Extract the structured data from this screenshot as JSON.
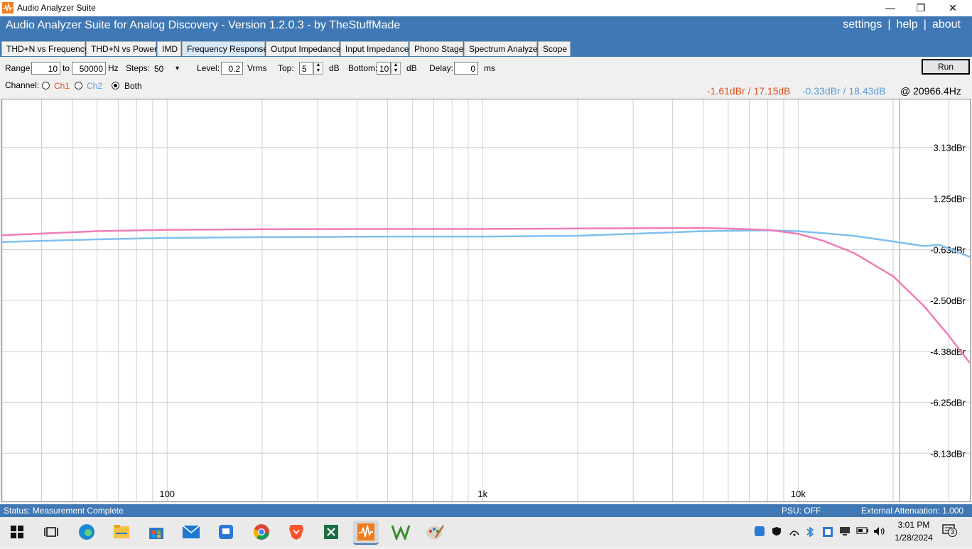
{
  "window": {
    "title": "Audio Analyzer Suite",
    "minimize": "—",
    "restore": "❐",
    "close": "✕"
  },
  "header": {
    "heading": "Audio Analyzer Suite for Analog Discovery - Version   1.2.0.3   - by TheStuffMade",
    "links": [
      "settings",
      "help",
      "about"
    ],
    "separator": "|"
  },
  "tabs": [
    "THD+N vs Frequency",
    "THD+N vs Power",
    "IMD",
    "Frequency Response",
    "Output Impedance",
    "Input Impedance",
    "Phono Stage",
    "Spectrum Analyzer",
    "Scope"
  ],
  "active_tab": 3,
  "controls": {
    "range_label": "Range:",
    "range_from": "10",
    "to_label": "to",
    "range_to": "50000",
    "hz_label": "Hz",
    "steps_label": "Steps:",
    "steps_value": "50",
    "steps_arrow": "▾",
    "level_label": "Level:",
    "level_value": "0.2",
    "vrms_label": "Vrms",
    "top_label": "Top:",
    "top_value": "5",
    "db1": "dB",
    "bottom_label": "Bottom:",
    "bottom_value": "10",
    "db2": "dB",
    "delay_label": "Delay:",
    "delay_value": "0",
    "ms_label": "ms",
    "run_label": "Run",
    "channel_label": "Channel:",
    "ch1": "Ch1",
    "ch2": "Ch2",
    "both": "Both",
    "selected_channel": "Both"
  },
  "readout": {
    "ch1": "-1.61dBr / 17.15dB",
    "ch2": "-0.33dBr / 18.43dB",
    "freq": "@ 20966.4Hz"
  },
  "colors": {
    "ch1": "#ef7db8",
    "ch2": "#7fc0ef",
    "cursor": "#d9b44a",
    "header": "#3f78b4",
    "ch1_text": "#e05020",
    "ch2_text": "#5b9bd5"
  },
  "chart_data": {
    "type": "line",
    "x_scale": "log",
    "xlim": [
      30,
      35000
    ],
    "ylim": [
      -9.9,
      4.9
    ],
    "x_tick_labels": [
      {
        "x": 100,
        "label": "100"
      },
      {
        "x": 1000,
        "label": "1k"
      },
      {
        "x": 10000,
        "label": "10k"
      }
    ],
    "y_ticks": [
      {
        "y": 3.13,
        "label": "3.13dBr"
      },
      {
        "y": 1.25,
        "label": "1.25dBr"
      },
      {
        "y": -0.63,
        "label": "-0.63dBr"
      },
      {
        "y": -2.5,
        "label": "-2.50dBr"
      },
      {
        "y": -4.38,
        "label": "-4.38dBr"
      },
      {
        "y": -6.25,
        "label": "-6.25dBr"
      },
      {
        "y": -8.13,
        "label": "-8.13dBr"
      }
    ],
    "cursor_x": 20966.4,
    "grid": true,
    "series": [
      {
        "name": "Ch1",
        "x": [
          30,
          60,
          100,
          200,
          500,
          1000,
          2000,
          5000,
          8000,
          10000,
          12000,
          15000,
          20000,
          25000,
          30000,
          35000
        ],
        "y": [
          -0.1,
          0.05,
          0.1,
          0.12,
          0.13,
          0.13,
          0.15,
          0.17,
          0.1,
          -0.05,
          -0.3,
          -0.75,
          -1.61,
          -2.7,
          -3.8,
          -4.8
        ]
      },
      {
        "name": "Ch2",
        "x": [
          30,
          60,
          100,
          200,
          500,
          1000,
          2000,
          5000,
          8000,
          10000,
          12000,
          15000,
          20000,
          25000,
          28000,
          35000
        ],
        "y": [
          -0.35,
          -0.25,
          -0.2,
          -0.17,
          -0.15,
          -0.15,
          -0.12,
          0.05,
          0.08,
          0.05,
          -0.02,
          -0.12,
          -0.33,
          -0.5,
          -0.45,
          -0.9
        ]
      }
    ]
  },
  "status": {
    "left": "Status: Measurement Complete",
    "psu": "PSU: OFF",
    "attenuation": "External Attenuation: 1.000"
  },
  "taskbar": {
    "icons": [
      "windows-start-icon",
      "task-view-icon",
      "edge-icon",
      "file-explorer-icon",
      "store-icon",
      "mail-icon",
      "remote-icon",
      "chrome-icon",
      "brave-icon",
      "excel-icon",
      "audio-analyzer-icon",
      "w-app-icon",
      "paint-icon"
    ],
    "time": "3:01 PM",
    "date": "1/28/2024",
    "notifications": "3"
  }
}
